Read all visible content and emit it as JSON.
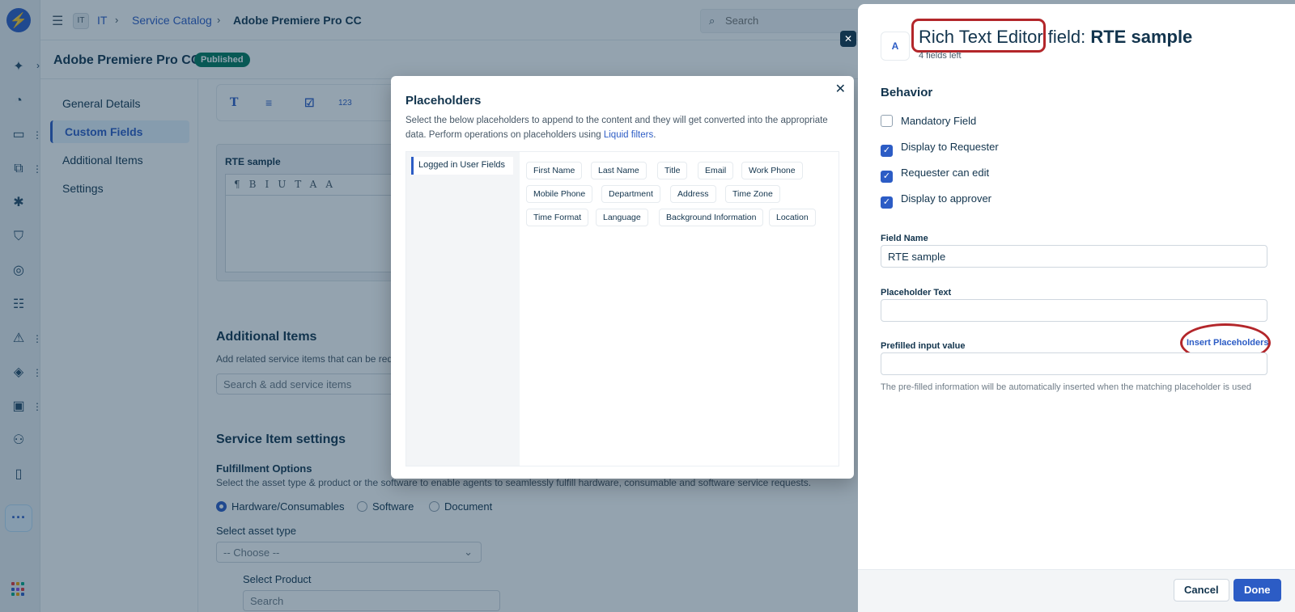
{
  "header": {
    "workspace_badge": "IT",
    "crumbs": [
      "IT",
      "Service Catalog",
      "Adobe Premiere Pro CC"
    ],
    "search_placeholder": "Search"
  },
  "subheader": {
    "title": "Adobe Premiere Pro CC",
    "status": "Published"
  },
  "leftnav": {
    "items": [
      "General Details",
      "Custom Fields",
      "Additional Items",
      "Settings"
    ]
  },
  "main": {
    "toolbar": [
      "T",
      "≡",
      "☑",
      "123"
    ],
    "rte_label": "RTE sample",
    "rte_tools": "¶BIUTAA",
    "additional_title": "Additional Items",
    "additional_sub": "Add related service items that can be reque",
    "additional_search": "Search & add service items",
    "settings_title": "Service Item settings",
    "fulfillment_title": "Fulfillment Options",
    "fulfillment_sub": "Select the asset type & product or the software to enable agents to seamlessly fulfill hardware, consumable and software service requests.",
    "radios": [
      "Hardware/Consumables",
      "Software",
      "Document"
    ],
    "asset_type_label": "Select asset type",
    "asset_type_value": "-- Choose --",
    "product_label": "Select Product",
    "product_value": "Search"
  },
  "modal": {
    "title": "Placeholders",
    "desc": "Select the below placeholders to append to the content and they will get converted into the appropriate data. Perform operations on placeholders using ",
    "desc_link": "Liquid filters",
    "desc_end": ".",
    "tab": "Logged in User Fields",
    "chips": [
      "First Name",
      "Last Name",
      "Title",
      "Email",
      "Work Phone",
      "Mobile Phone",
      "Department",
      "Address",
      "Time Zone",
      "Time Format",
      "Language",
      "Background Information",
      "Location"
    ]
  },
  "panel": {
    "icon": "A",
    "title_prefix": "Rich Text Editor",
    "title_mid": " field: ",
    "title_name": "RTE sample",
    "fields_left": "4 fields left",
    "behavior_title": "Behavior",
    "checkboxes": [
      {
        "label": "Mandatory Field",
        "checked": false
      },
      {
        "label": "Display to Requester",
        "checked": true
      },
      {
        "label": "Requester can edit",
        "checked": true
      },
      {
        "label": "Display to approver",
        "checked": true
      }
    ],
    "field_name_label": "Field Name",
    "field_name_value": "RTE sample",
    "placeholder_label": "Placeholder Text",
    "placeholder_value": "",
    "prefilled_label": "Prefilled input value",
    "insert_link": "Insert Placeholders",
    "prefilled_value": "",
    "help": "The pre-filled information will be automatically inserted when the matching placeholder is used",
    "cancel": "Cancel",
    "done": "Done"
  },
  "colors": {
    "accent": "#2c5cc5",
    "published": "#00795b",
    "annotation": "#b3262a"
  }
}
